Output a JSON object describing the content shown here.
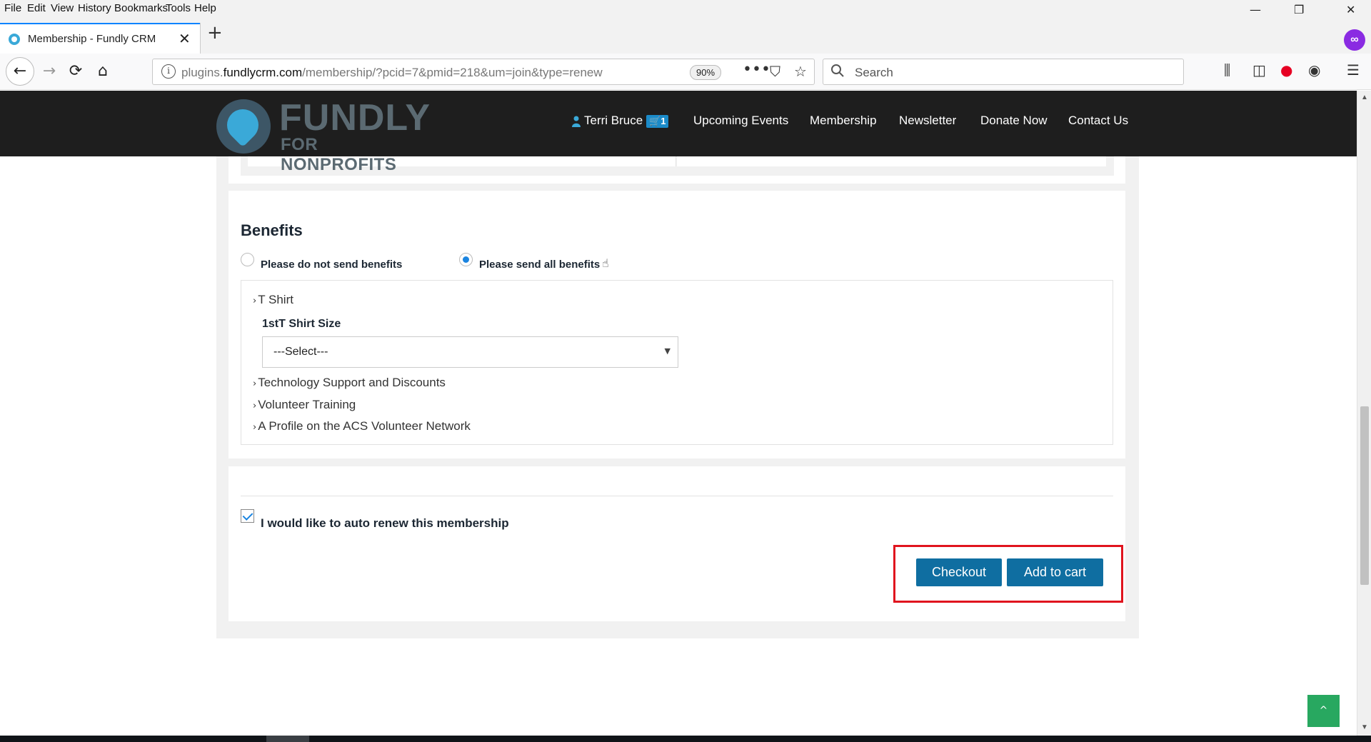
{
  "menubar": {
    "items": [
      "File",
      "Edit",
      "View",
      "History",
      "Bookmarks",
      "Tools",
      "Help"
    ]
  },
  "window_controls": {
    "minimize": "—",
    "restore": "❐",
    "close": "✕"
  },
  "tab": {
    "title": "Membership - Fundly CRM",
    "close": "✕",
    "new_tab": "+"
  },
  "navbar": {
    "url_prefix": "plugins.",
    "url_host": "fundlycrm.com",
    "url_path": "/membership/?pcid=7&pmid=218&um=join&type=renew",
    "zoom": "90%",
    "search_placeholder": "Search"
  },
  "site": {
    "logo_text": "FUNDLY",
    "logo_sub": "FOR NONPROFITS",
    "nav": {
      "user": "Terri Bruce",
      "cart_count": "1",
      "items": [
        "Upcoming Events",
        "Membership",
        "Newsletter",
        "Donate Now",
        "Contact Us"
      ]
    }
  },
  "benefits": {
    "title": "Benefits",
    "option_no": "Please do not send benefits",
    "option_all": "Please send all benefits",
    "selected": "option_all",
    "items": [
      "T Shirt",
      "Technology Support and Discounts",
      "Volunteer Training",
      "A Profile on the ACS Volunteer Network"
    ],
    "size_label": "1stT Shirt Size",
    "size_value": "---Select---"
  },
  "renew": {
    "label": "I would like to auto renew this membership",
    "checked": true,
    "checkout": "Checkout",
    "add_to_cart": "Add to cart"
  },
  "colors": {
    "accent": "#0f6ea1",
    "header_bg": "#1e1e1e",
    "highlight": "#e0141e",
    "back_to_top": "#28a860"
  }
}
